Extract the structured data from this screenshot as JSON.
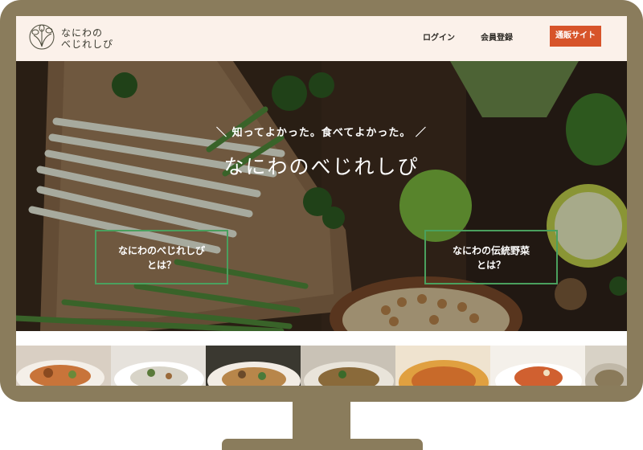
{
  "header": {
    "logo_line1": "なにわの",
    "logo_line2": "べじれしぴ",
    "nav_login": "ログイン",
    "nav_register": "会員登録",
    "shop_button": "通販サイト"
  },
  "hero": {
    "tagline": "＼ 知ってよかった。食べてよかった。 ／",
    "title": "なにわのべじれしぴ",
    "link1_line1": "なにわのべじれしぴ",
    "link1_line2": "とは？",
    "link2_line1": "なにわの伝統野菜",
    "link2_line2": "とは？"
  },
  "colors": {
    "frame": "#8a7c5c",
    "header_bg": "#fbf1ea",
    "accent": "#d7542a",
    "link_border": "#4aa05e"
  },
  "icons": [
    "logo-flower-icon"
  ]
}
